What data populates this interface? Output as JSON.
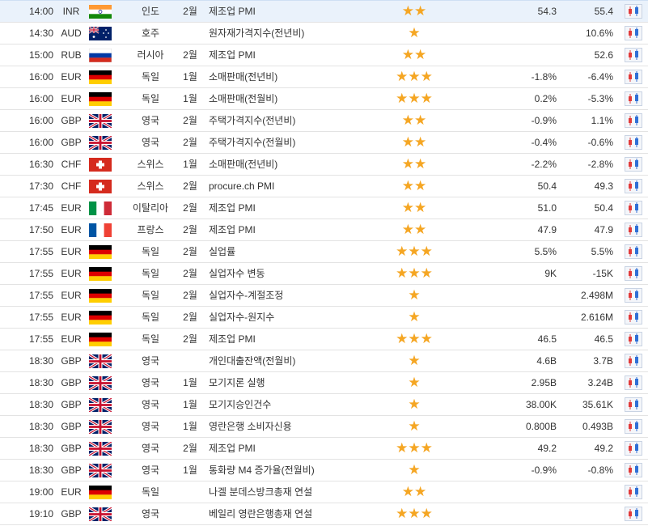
{
  "colors": {
    "star": "#f5a623",
    "row_highlight": "#eaf2fb",
    "chart_red": "#e23b3b",
    "chart_blue": "#2f6fd6"
  },
  "rows": [
    {
      "time": "14:00",
      "currency": "INR",
      "flag": "india-flag-icon",
      "country": "인도",
      "period": "2월",
      "event": "제조업 PMI",
      "importance": 2,
      "actual": "54.3",
      "forecast": "55.4"
    },
    {
      "time": "14:30",
      "currency": "AUD",
      "flag": "australia-flag-icon",
      "country": "호주",
      "period": "",
      "event": "원자재가격지수(전년비)",
      "importance": 1,
      "actual": "",
      "forecast": "10.6%"
    },
    {
      "time": "15:00",
      "currency": "RUB",
      "flag": "russia-flag-icon",
      "country": "러시아",
      "period": "2월",
      "event": "제조업 PMI",
      "importance": 2,
      "actual": "",
      "forecast": "52.6"
    },
    {
      "time": "16:00",
      "currency": "EUR",
      "flag": "germany-flag-icon",
      "country": "독일",
      "period": "1월",
      "event": "소매판매(전년비)",
      "importance": 3,
      "actual": "-1.8%",
      "forecast": "-6.4%"
    },
    {
      "time": "16:00",
      "currency": "EUR",
      "flag": "germany-flag-icon",
      "country": "독일",
      "period": "1월",
      "event": "소매판매(전월비)",
      "importance": 3,
      "actual": "0.2%",
      "forecast": "-5.3%"
    },
    {
      "time": "16:00",
      "currency": "GBP",
      "flag": "uk-flag-icon",
      "country": "영국",
      "period": "2월",
      "event": "주택가격지수(전년비)",
      "importance": 2,
      "actual": "-0.9%",
      "forecast": "1.1%"
    },
    {
      "time": "16:00",
      "currency": "GBP",
      "flag": "uk-flag-icon",
      "country": "영국",
      "period": "2월",
      "event": "주택가격지수(전월비)",
      "importance": 2,
      "actual": "-0.4%",
      "forecast": "-0.6%"
    },
    {
      "time": "16:30",
      "currency": "CHF",
      "flag": "switzerland-flag-icon",
      "country": "스위스",
      "period": "1월",
      "event": "소매판매(전년비)",
      "importance": 2,
      "actual": "-2.2%",
      "forecast": "-2.8%"
    },
    {
      "time": "17:30",
      "currency": "CHF",
      "flag": "switzerland-flag-icon",
      "country": "스위스",
      "period": "2월",
      "event": "procure.ch PMI",
      "importance": 2,
      "actual": "50.4",
      "forecast": "49.3"
    },
    {
      "time": "17:45",
      "currency": "EUR",
      "flag": "italy-flag-icon",
      "country": "이탈리아",
      "period": "2월",
      "event": "제조업 PMI",
      "importance": 2,
      "actual": "51.0",
      "forecast": "50.4"
    },
    {
      "time": "17:50",
      "currency": "EUR",
      "flag": "france-flag-icon",
      "country": "프랑스",
      "period": "2월",
      "event": "제조업 PMI",
      "importance": 2,
      "actual": "47.9",
      "forecast": "47.9"
    },
    {
      "time": "17:55",
      "currency": "EUR",
      "flag": "germany-flag-icon",
      "country": "독일",
      "period": "2월",
      "event": "실업률",
      "importance": 3,
      "actual": "5.5%",
      "forecast": "5.5%"
    },
    {
      "time": "17:55",
      "currency": "EUR",
      "flag": "germany-flag-icon",
      "country": "독일",
      "period": "2월",
      "event": "실업자수 변동",
      "importance": 3,
      "actual": "9K",
      "forecast": "-15K"
    },
    {
      "time": "17:55",
      "currency": "EUR",
      "flag": "germany-flag-icon",
      "country": "독일",
      "period": "2월",
      "event": "실업자수-계절조정",
      "importance": 1,
      "actual": "",
      "forecast": "2.498M"
    },
    {
      "time": "17:55",
      "currency": "EUR",
      "flag": "germany-flag-icon",
      "country": "독일",
      "period": "2월",
      "event": "실업자수-원지수",
      "importance": 1,
      "actual": "",
      "forecast": "2.616M"
    },
    {
      "time": "17:55",
      "currency": "EUR",
      "flag": "germany-flag-icon",
      "country": "독일",
      "period": "2월",
      "event": "제조업 PMI",
      "importance": 3,
      "actual": "46.5",
      "forecast": "46.5"
    },
    {
      "time": "18:30",
      "currency": "GBP",
      "flag": "uk-flag-icon",
      "country": "영국",
      "period": "",
      "event": "개인대출잔액(전월비)",
      "importance": 1,
      "actual": "4.6B",
      "forecast": "3.7B"
    },
    {
      "time": "18:30",
      "currency": "GBP",
      "flag": "uk-flag-icon",
      "country": "영국",
      "period": "1월",
      "event": "모기지론 실행",
      "importance": 1,
      "actual": "2.95B",
      "forecast": "3.24B"
    },
    {
      "time": "18:30",
      "currency": "GBP",
      "flag": "uk-flag-icon",
      "country": "영국",
      "period": "1월",
      "event": "모기지승인건수",
      "importance": 1,
      "actual": "38.00K",
      "forecast": "35.61K"
    },
    {
      "time": "18:30",
      "currency": "GBP",
      "flag": "uk-flag-icon",
      "country": "영국",
      "period": "1월",
      "event": "영란은행 소비자신용",
      "importance": 1,
      "actual": "0.800B",
      "forecast": "0.493B"
    },
    {
      "time": "18:30",
      "currency": "GBP",
      "flag": "uk-flag-icon",
      "country": "영국",
      "period": "2월",
      "event": "제조업 PMI",
      "importance": 3,
      "actual": "49.2",
      "forecast": "49.2"
    },
    {
      "time": "18:30",
      "currency": "GBP",
      "flag": "uk-flag-icon",
      "country": "영국",
      "period": "1월",
      "event": "통화량 M4 증가율(전월비)",
      "importance": 1,
      "actual": "-0.9%",
      "forecast": "-0.8%"
    },
    {
      "time": "19:00",
      "currency": "EUR",
      "flag": "germany-flag-icon",
      "country": "독일",
      "period": "",
      "event": "나겔 분데스방크총재 연설",
      "importance": 2,
      "actual": "",
      "forecast": ""
    },
    {
      "time": "19:10",
      "currency": "GBP",
      "flag": "uk-flag-icon",
      "country": "영국",
      "period": "",
      "event": "베일리 영란은행총재 연설",
      "importance": 3,
      "actual": "",
      "forecast": ""
    }
  ]
}
